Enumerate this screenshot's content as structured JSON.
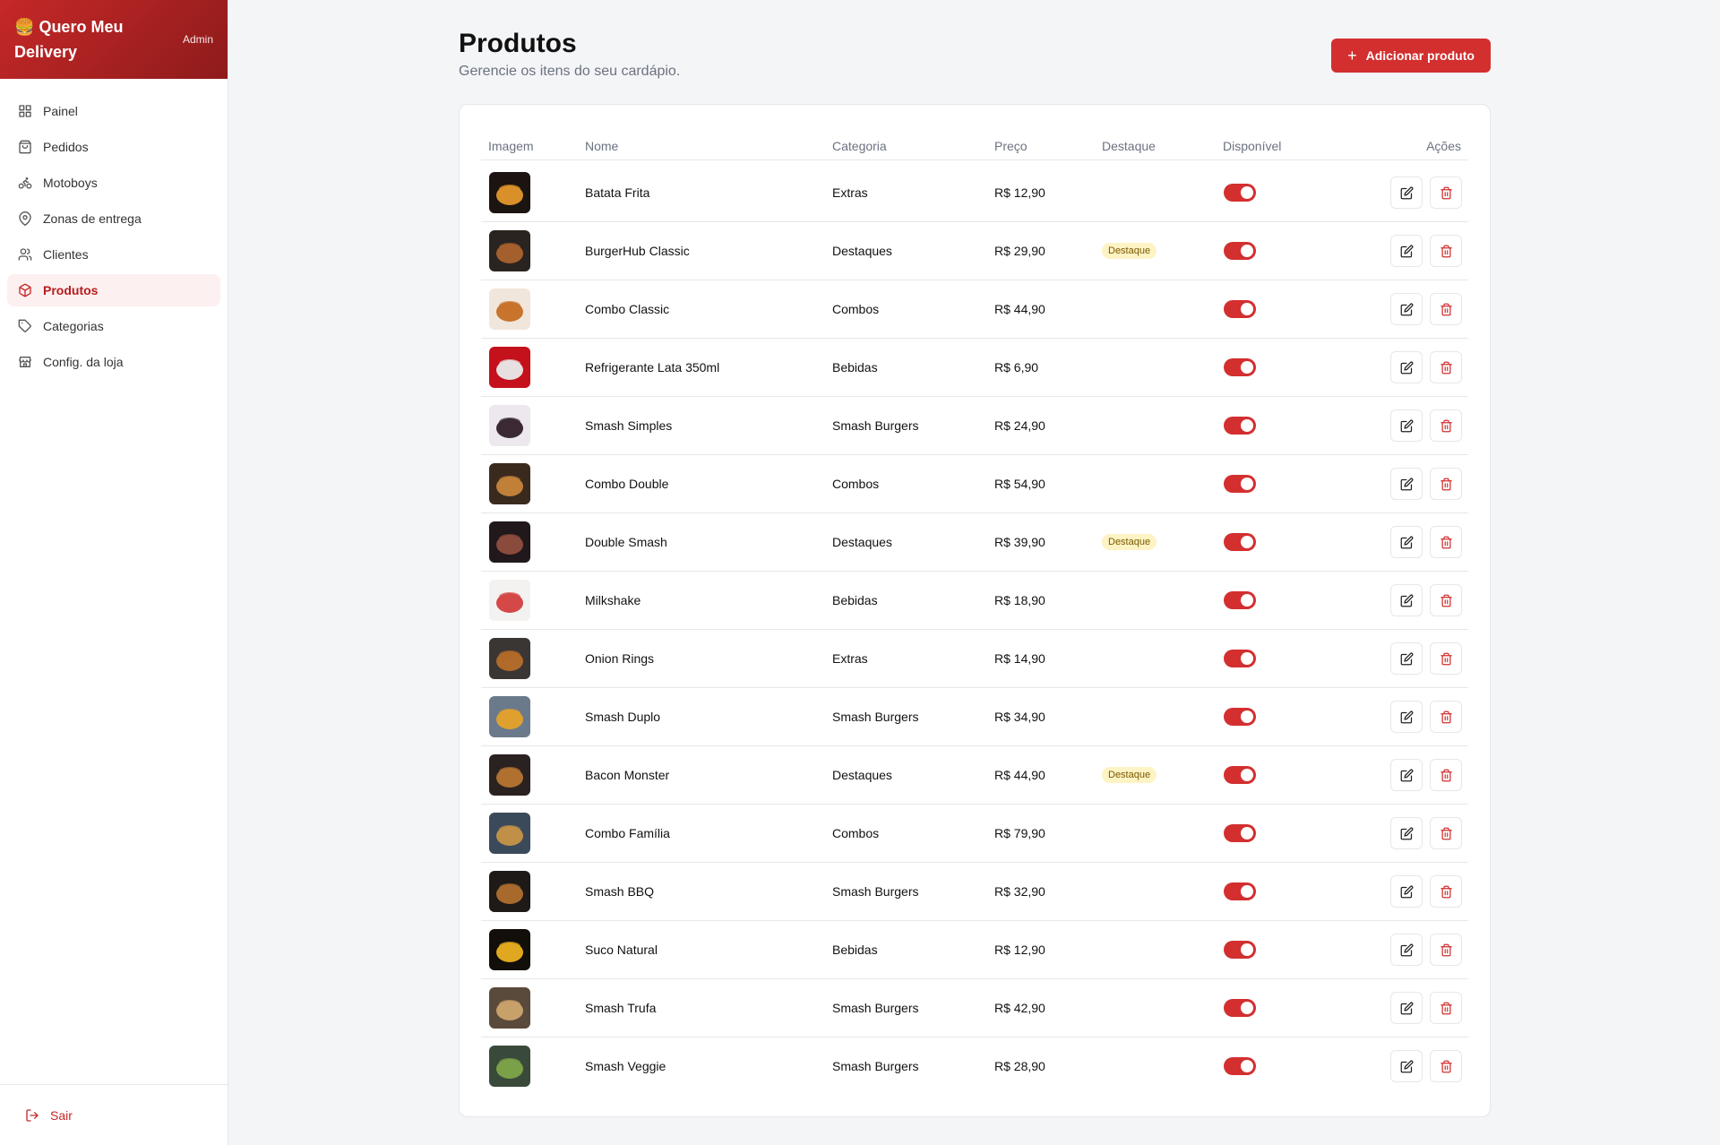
{
  "brand": {
    "emoji": "🍔",
    "name": "Quero Meu Delivery",
    "badge": "Admin"
  },
  "nav": [
    {
      "label": "Painel",
      "icon": "grid-icon",
      "active": false
    },
    {
      "label": "Pedidos",
      "icon": "bag-icon",
      "active": false
    },
    {
      "label": "Motoboys",
      "icon": "bike-icon",
      "active": false
    },
    {
      "label": "Zonas de entrega",
      "icon": "map-pin-icon",
      "active": false
    },
    {
      "label": "Clientes",
      "icon": "users-icon",
      "active": false
    },
    {
      "label": "Produtos",
      "icon": "box-icon",
      "active": true
    },
    {
      "label": "Categorias",
      "icon": "tag-icon",
      "active": false
    },
    {
      "label": "Config. da loja",
      "icon": "store-icon",
      "active": false
    }
  ],
  "logout_label": "Sair",
  "page": {
    "title": "Produtos",
    "subtitle": "Gerencie os itens do seu cardápio.",
    "add_button": "Adicionar produto"
  },
  "table": {
    "headers": {
      "image": "Imagem",
      "name": "Nome",
      "category": "Categoria",
      "price": "Preço",
      "featured": "Destaque",
      "available": "Disponível",
      "actions": "Ações"
    },
    "featured_label": "Destaque",
    "rows": [
      {
        "name": "Batata Frita",
        "category": "Extras",
        "price": "R$ 12,90",
        "featured": false,
        "available": true,
        "thumb": [
          "#1c1410",
          "#d9902a"
        ]
      },
      {
        "name": "BurgerHub Classic",
        "category": "Destaques",
        "price": "R$ 29,90",
        "featured": true,
        "available": true,
        "thumb": [
          "#2a2420",
          "#a4602c"
        ]
      },
      {
        "name": "Combo Classic",
        "category": "Combos",
        "price": "R$ 44,90",
        "featured": false,
        "available": true,
        "thumb": [
          "#f1e6dc",
          "#c8742c"
        ]
      },
      {
        "name": "Refrigerante Lata 350ml",
        "category": "Bebidas",
        "price": "R$ 6,90",
        "featured": false,
        "available": true,
        "thumb": [
          "#c4111b",
          "#e8e0e0"
        ]
      },
      {
        "name": "Smash Simples",
        "category": "Smash Burgers",
        "price": "R$ 24,90",
        "featured": false,
        "available": true,
        "thumb": [
          "#ece8ee",
          "#3b2a33"
        ]
      },
      {
        "name": "Combo Double",
        "category": "Combos",
        "price": "R$ 54,90",
        "featured": false,
        "available": true,
        "thumb": [
          "#3a2a1e",
          "#c08038"
        ]
      },
      {
        "name": "Double Smash",
        "category": "Destaques",
        "price": "R$ 39,90",
        "featured": true,
        "available": true,
        "thumb": [
          "#20181a",
          "#8a4a3c"
        ]
      },
      {
        "name": "Milkshake",
        "category": "Bebidas",
        "price": "R$ 18,90",
        "featured": false,
        "available": true,
        "thumb": [
          "#f4f2f0",
          "#d44848"
        ]
      },
      {
        "name": "Onion Rings",
        "category": "Extras",
        "price": "R$ 14,90",
        "featured": false,
        "available": true,
        "thumb": [
          "#3a3634",
          "#b06a2a"
        ]
      },
      {
        "name": "Smash Duplo",
        "category": "Smash Burgers",
        "price": "R$ 34,90",
        "featured": false,
        "available": true,
        "thumb": [
          "#6a7a8a",
          "#e0a030"
        ]
      },
      {
        "name": "Bacon Monster",
        "category": "Destaques",
        "price": "R$ 44,90",
        "featured": true,
        "available": true,
        "thumb": [
          "#2a2220",
          "#b07030"
        ]
      },
      {
        "name": "Combo Família",
        "category": "Combos",
        "price": "R$ 79,90",
        "featured": false,
        "available": true,
        "thumb": [
          "#3a4a5a",
          "#c09048"
        ]
      },
      {
        "name": "Smash BBQ",
        "category": "Smash Burgers",
        "price": "R$ 32,90",
        "featured": false,
        "available": true,
        "thumb": [
          "#1e1a18",
          "#a86a2c"
        ]
      },
      {
        "name": "Suco Natural",
        "category": "Bebidas",
        "price": "R$ 12,90",
        "featured": false,
        "available": true,
        "thumb": [
          "#120e0a",
          "#e0a820"
        ]
      },
      {
        "name": "Smash Trufa",
        "category": "Smash Burgers",
        "price": "R$ 42,90",
        "featured": false,
        "available": true,
        "thumb": [
          "#5a4a3c",
          "#c8a06a"
        ]
      },
      {
        "name": "Smash Veggie",
        "category": "Smash Burgers",
        "price": "R$ 28,90",
        "featured": false,
        "available": true,
        "thumb": [
          "#3a4a3a",
          "#7aa048"
        ]
      }
    ]
  }
}
